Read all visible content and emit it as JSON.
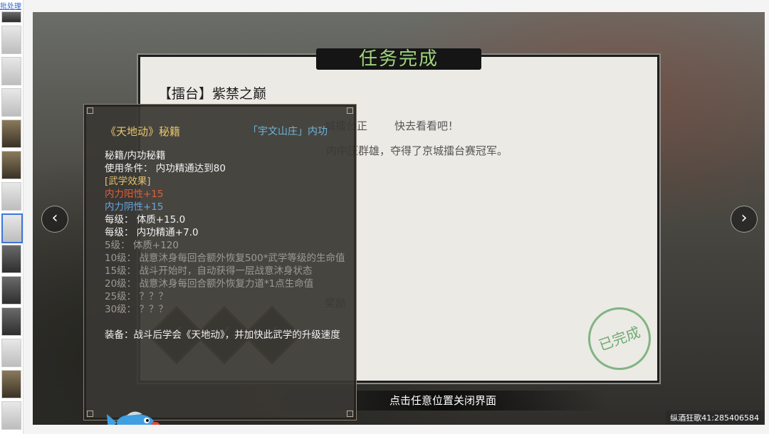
{
  "sidebar": {
    "link_label": "批处理",
    "thumb_count": 13
  },
  "viewer": {
    "prev_label": "‹",
    "next_label": "›",
    "watermark": "纵酒狂歌41:285406584"
  },
  "quest": {
    "banner": "任务完成",
    "title": "【擂台】紫禁之巅",
    "line1": "城擂台正",
    "line1_tail": "快去看看吧！",
    "line2": "内中压群雄，夺得了京城擂台赛冠军。",
    "reward_section": "奖励",
    "stamp": "已完成",
    "close_hint": "点击任意位置关闭界面"
  },
  "tooltip": {
    "title": "《天地动》秘籍",
    "school": "「宇文山庄」内功",
    "category": "秘籍/内功秘籍",
    "requirement": "使用条件：  内功精通达到80",
    "effects_header": "[武学效果]",
    "yang": "内力阳性+15",
    "yin": "内力阴性+15",
    "per_level_1": "每级：  体质+15.0",
    "per_level_2": "每级：  内功精通+7.0",
    "lv5": "5级：  体质+120",
    "lv10": "10级：  战意沐身每回合额外恢复500*武学等级的生命值",
    "lv15": "15级：  战斗开始时，自动获得一层战意沐身状态",
    "lv20": "20级：  战意沐身每回合额外恢复力道*1点生命值",
    "lv25": "25级：  ？？？",
    "lv30": "30级：  ？？？",
    "equip": "装备：战斗后学会《天地动》，并加快此武学的升级速度"
  },
  "colors": {
    "gold": "#e0c070",
    "blue": "#6aa6e0",
    "red": "#e0603c",
    "banner_green": "#9fd37c"
  }
}
